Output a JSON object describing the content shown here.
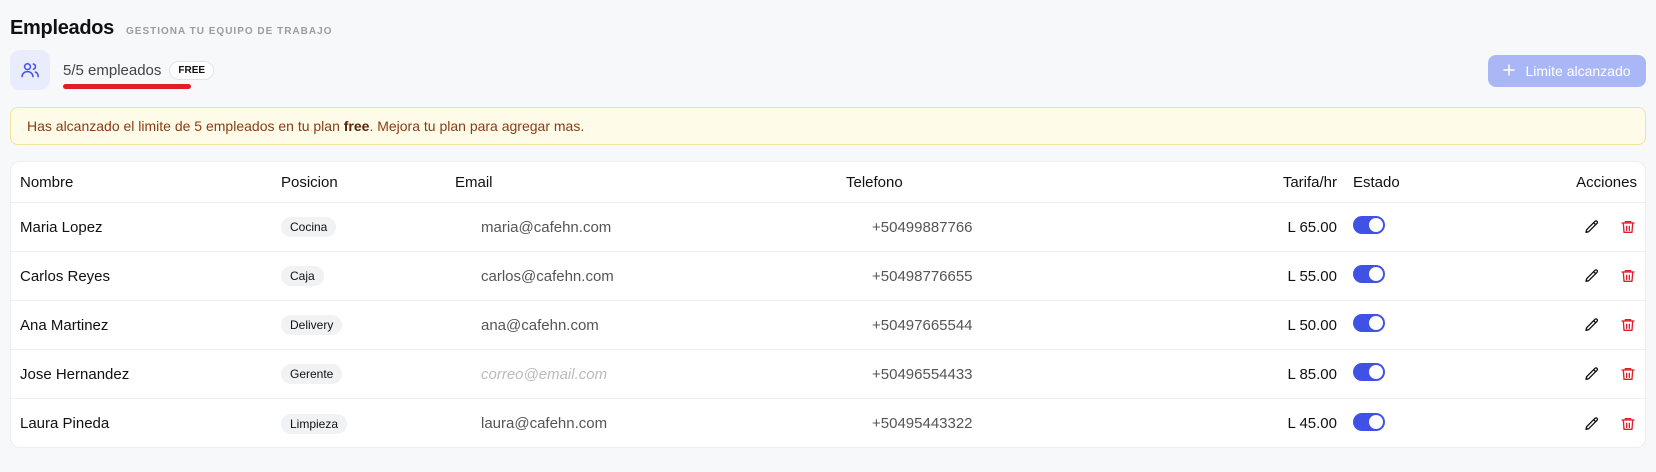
{
  "header": {
    "title": "Empleados",
    "subtitle": "GESTIONA TU EQUIPO DE TRABAJO"
  },
  "counter": {
    "text": "5/5 empleados",
    "plan_badge": "FREE",
    "icon": "users-icon"
  },
  "limit_button": {
    "label": "Limite alcanzado",
    "icon": "plus-icon"
  },
  "alert": {
    "before": "Has alcanzado el limite de 5 empleados en tu plan ",
    "bold": "free",
    "after": ". Mejora tu plan para agregar mas."
  },
  "table": {
    "columns": [
      "Nombre",
      "Posicion",
      "Email",
      "Telefono",
      "Tarifa/hr",
      "Estado",
      "Acciones"
    ],
    "rows": [
      {
        "name": "Maria Lopez",
        "position": "Cocina",
        "email": "maria@cafehn.com",
        "email_is_placeholder": false,
        "phone": "+50499887766",
        "rate": "L 65.00",
        "active": true
      },
      {
        "name": "Carlos Reyes",
        "position": "Caja",
        "email": "carlos@cafehn.com",
        "email_is_placeholder": false,
        "phone": "+50498776655",
        "rate": "L 55.00",
        "active": true
      },
      {
        "name": "Ana Martinez",
        "position": "Delivery",
        "email": "ana@cafehn.com",
        "email_is_placeholder": false,
        "phone": "+50497665544",
        "rate": "L 50.00",
        "active": true
      },
      {
        "name": "Jose Hernandez",
        "position": "Gerente",
        "email": "correo@email.com",
        "email_is_placeholder": true,
        "phone": "+50496554433",
        "rate": "L 85.00",
        "active": true
      },
      {
        "name": "Laura Pineda",
        "position": "Limpieza",
        "email": "laura@cafehn.com",
        "email_is_placeholder": false,
        "phone": "+50495443322",
        "rate": "L 45.00",
        "active": true
      }
    ]
  },
  "colors": {
    "accent": "#4051e6",
    "accent_disabled": "#a9b7f7",
    "danger": "#e11d2a",
    "alert_bg": "#fefbe8",
    "alert_text": "#8a3c12"
  }
}
